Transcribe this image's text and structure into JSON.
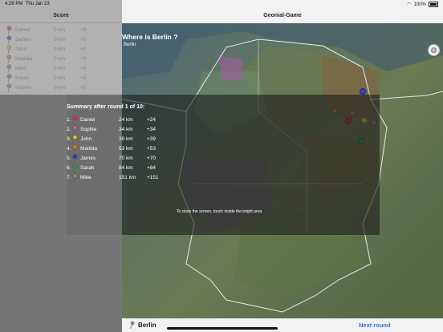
{
  "status_bar": {
    "time": "4:26 PM",
    "date": "Thu Jan 23",
    "battery": "100%"
  },
  "score_panel": {
    "title": "Score",
    "rows": [
      {
        "name": "Daniel",
        "dist": "0 km",
        "pts": "+0",
        "color": "#d33"
      },
      {
        "name": "James",
        "dist": "0 km",
        "pts": "+0",
        "color": "#2a45c9"
      },
      {
        "name": "John",
        "dist": "0 km",
        "pts": "+0",
        "color": "#e3c51f"
      },
      {
        "name": "Matilda",
        "dist": "0 km",
        "pts": "+0",
        "color": "#e07b1f"
      },
      {
        "name": "Mike",
        "dist": "0 km",
        "pts": "+0",
        "color": "#888888"
      },
      {
        "name": "Sarah",
        "dist": "0 km",
        "pts": "+0",
        "color": "#2aa33a"
      },
      {
        "name": "Sophie",
        "dist": "0 km",
        "pts": "+0",
        "color": "#b06fa0"
      }
    ]
  },
  "header": {
    "title": "Geonial-Game"
  },
  "question": {
    "prompt": "Where is Berlin ?",
    "answer": "Berlin"
  },
  "summary": {
    "title": "Summary after round 1 of 10:",
    "rows": [
      {
        "rank": "1.",
        "name": "Daniel",
        "dist": "24 km",
        "pts": "+24",
        "color": "#d33"
      },
      {
        "rank": "2.",
        "name": "Sophie",
        "dist": "34 km",
        "pts": "+34",
        "color": "#b06fa0"
      },
      {
        "rank": "3.",
        "name": "John",
        "dist": "39 km",
        "pts": "+39",
        "color": "#e3c51f"
      },
      {
        "rank": "4.",
        "name": "Matilda",
        "dist": "53 km",
        "pts": "+53",
        "color": "#e07b1f"
      },
      {
        "rank": "5.",
        "name": "James",
        "dist": "70 km",
        "pts": "+70",
        "color": "#2a45c9"
      },
      {
        "rank": "6.",
        "name": "Sarah",
        "dist": "84 km",
        "pts": "+84",
        "color": "#2aa33a"
      },
      {
        "rank": "7.",
        "name": "Mike",
        "dist": "151 km",
        "pts": "+151",
        "color": "#888888"
      }
    ],
    "close_hint": "To close the screen, touch inside the bright area."
  },
  "bottom_bar": {
    "location_label": "Berlin",
    "next_round": "Next round"
  }
}
